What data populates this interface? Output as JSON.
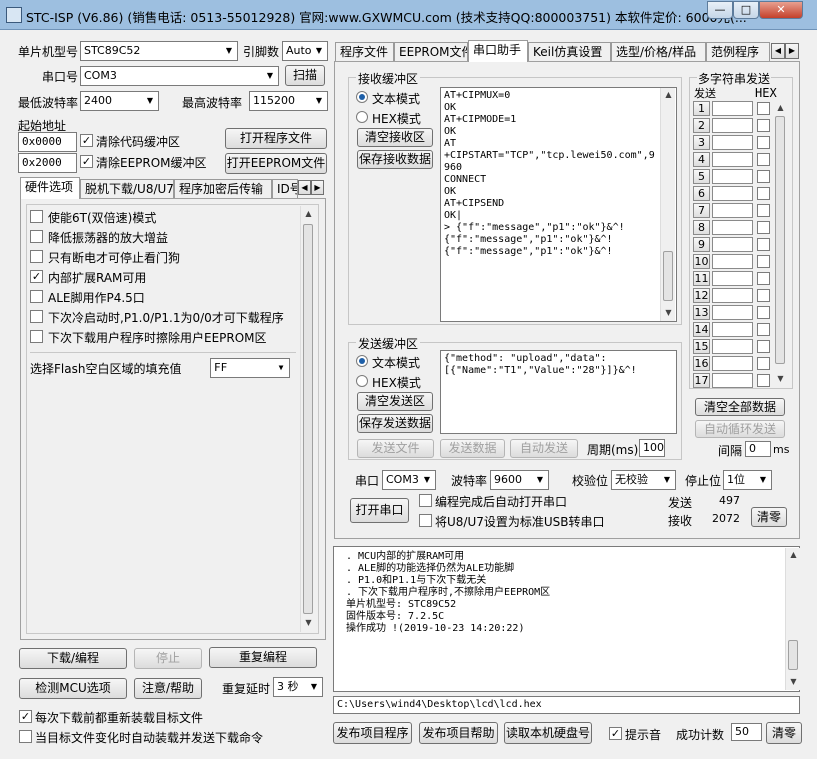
{
  "window": {
    "title": "STC-ISP (V6.86) (销售电话: 0513-55012928) 官网:www.GXWMCU.com  (技术支持QQ:800003751) 本软件定价: 6000元(...",
    "min": "—",
    "max": "□",
    "close": "✕"
  },
  "left": {
    "mcu_type_label": "单片机型号",
    "mcu_type_value": "STC89C52",
    "pin_label": "引脚数",
    "pin_value": "Auto",
    "port_label": "串口号",
    "port_value": "COM3",
    "scan_label": "扫描",
    "min_baud_label": "最低波特率",
    "min_baud_value": "2400",
    "max_baud_label": "最高波特率",
    "max_baud_value": "115200",
    "start_addr_label": "起始地址",
    "addr1": "0x0000",
    "clear_code_label": "清除代码缓冲区",
    "open_prog_label": "打开程序文件",
    "addr2": "0x2000",
    "clear_eeprom_label": "清除EEPROM缓冲区",
    "open_eeprom_label": "打开EEPROM文件",
    "tabs": [
      "硬件选项",
      "脱机下载/U8/U7",
      "程序加密后传输",
      "ID号"
    ],
    "options": [
      {
        "label": "使能6T(双倍速)模式",
        "checked": false
      },
      {
        "label": "降低振荡器的放大增益",
        "checked": false
      },
      {
        "label": "只有断电才可停止看门狗",
        "checked": false
      },
      {
        "label": "内部扩展RAM可用",
        "checked": true
      },
      {
        "label": "ALE脚用作P4.5口",
        "checked": false
      },
      {
        "label": "下次冷启动时,P1.0/P1.1为0/0才可下载程序",
        "checked": false
      },
      {
        "label": "下次下载用户程序时擦除用户EEPROM区",
        "checked": false
      }
    ],
    "fill_label": "选择Flash空白区域的填充值",
    "fill_value": "FF",
    "download_label": "下载/编程",
    "stop_label": "停止",
    "reprogram_label": "重复编程",
    "check_mcu_label": "检测MCU选项",
    "help_label": "注意/帮助",
    "delay_label": "重复延时",
    "delay_value": "3 秒",
    "reload_label": "每次下载前都重新装载目标文件",
    "auto_load_label": "当目标文件变化时自动装载并发送下载命令"
  },
  "right": {
    "tabs": [
      "程序文件",
      "EEPROM文件",
      "串口助手",
      "Keil仿真设置",
      "选型/价格/样品",
      "范例程序"
    ],
    "recv": {
      "group_label": "接收缓冲区",
      "text_mode": "文本模式",
      "hex_mode": "HEX模式",
      "clear_btn": "清空接收区",
      "save_btn": "保存接收数据",
      "lines": [
        "AT+CIPMUX=0",
        "",
        "OK",
        "AT+CIPMODE=1",
        "",
        "OK",
        "AT",
        "+CIPSTART=\"TCP\",\"tcp.lewei50.com\",9",
        "960",
        "CONNECT",
        "",
        "OK",
        "AT+CIPSEND",
        "",
        "OK|",
        "",
        "> {\"f\":\"message\",\"p1\":\"ok\"}&^!",
        "{\"f\":\"message\",\"p1\":\"ok\"}&^!",
        "{\"f\":\"message\",\"p1\":\"ok\"}&^!"
      ]
    },
    "multi": {
      "title": "多字符串发送",
      "send_col": "发送",
      "hex_col": "HEX",
      "rows": [
        "1",
        "2",
        "3",
        "4",
        "5",
        "6",
        "7",
        "8",
        "9",
        "10",
        "11",
        "12",
        "13",
        "14",
        "15",
        "16",
        "17"
      ],
      "clear_all": "清空全部数据",
      "auto_loop": "自动循环发送",
      "interval_label": "间隔",
      "interval_value": "0",
      "interval_unit": "ms"
    },
    "send": {
      "group_label": "发送缓冲区",
      "text_mode": "文本模式",
      "hex_mode": "HEX模式",
      "clear_btn": "清空发送区",
      "save_btn": "保存发送数据",
      "lines": [
        "{\"method\": \"upload\",\"data\":",
        "[{\"Name\":\"T1\",\"Value\":\"28\"}]}&^!"
      ],
      "send_file": "发送文件",
      "send_data": "发送数据",
      "auto_send": "自动发送",
      "period_label": "周期(ms)",
      "period_value": "100"
    },
    "serial": {
      "port_label": "串口",
      "port_value": "COM3",
      "baud_label": "波特率",
      "baud_value": "9600",
      "parity_label": "校验位",
      "parity_value": "无校验",
      "stop_label": "停止位",
      "stop_value": "1位",
      "open_btn": "打开串口",
      "auto_open_label": "编程完成后自动打开串口",
      "usb_label": "将U8/U7设置为标准USB转串口",
      "sent_label": "发送",
      "sent_value": "497",
      "recv_label": "接收",
      "recv_value": "2072",
      "clear_btn": "清零"
    },
    "log": {
      "lines": [
        ". MCU内部的扩展RAM可用",
        ". ALE脚的功能选择仍然为ALE功能脚",
        ". P1.0和P1.1与下次下载无关",
        ". 下次下载用户程序时,不擦除用户EEPROM区",
        "",
        "单片机型号: STC89C52",
        "固件版本号: 7.2.5C",
        "",
        "",
        "操作成功 !(2019-10-23 14:20:22)"
      ]
    },
    "path": "C:\\Users\\wind4\\Desktop\\lcd\\lcd.hex",
    "bottom": {
      "publish_prog": "发布项目程序",
      "publish_help": "发布项目帮助",
      "read_disk": "读取本机硬盘号",
      "beep_label": "提示音",
      "success_label": "成功计数",
      "success_value": "50",
      "clear_btn": "清零"
    }
  }
}
